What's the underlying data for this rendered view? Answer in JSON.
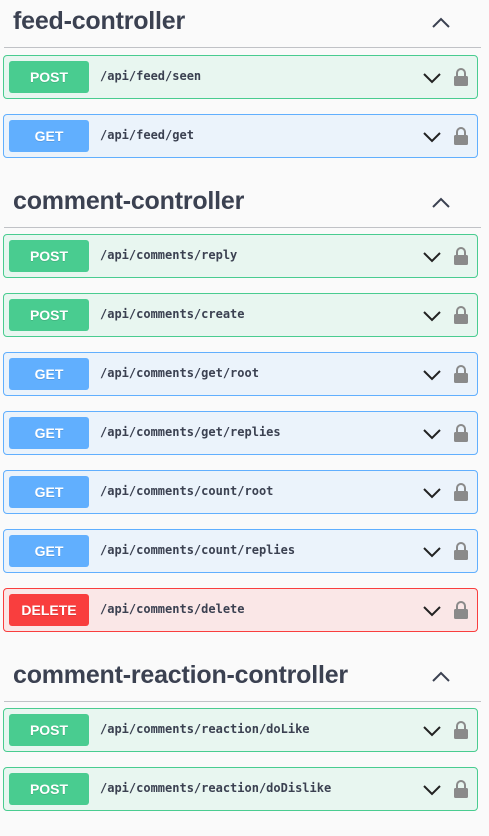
{
  "sections": [
    {
      "title": "feed-controller",
      "operations": [
        {
          "method": "POST",
          "path": "/api/feed/seen"
        },
        {
          "method": "GET",
          "path": "/api/feed/get"
        }
      ]
    },
    {
      "title": "comment-controller",
      "operations": [
        {
          "method": "POST",
          "path": "/api/comments/reply"
        },
        {
          "method": "POST",
          "path": "/api/comments/create"
        },
        {
          "method": "GET",
          "path": "/api/comments/get/root"
        },
        {
          "method": "GET",
          "path": "/api/comments/get/replies"
        },
        {
          "method": "GET",
          "path": "/api/comments/count/root"
        },
        {
          "method": "GET",
          "path": "/api/comments/count/replies"
        },
        {
          "method": "DELETE",
          "path": "/api/comments/delete"
        }
      ]
    },
    {
      "title": "comment-reaction-controller",
      "operations": [
        {
          "method": "POST",
          "path": "/api/comments/reaction/doLike"
        },
        {
          "method": "POST",
          "path": "/api/comments/reaction/doDislike"
        }
      ]
    }
  ],
  "colors": {
    "post": "#49cc90",
    "get": "#61affe",
    "delete": "#f93e3e"
  },
  "icons": {
    "section_toggle": "chevron-up-icon",
    "operation_expand": "chevron-down-icon",
    "operation_auth": "lock-icon"
  }
}
